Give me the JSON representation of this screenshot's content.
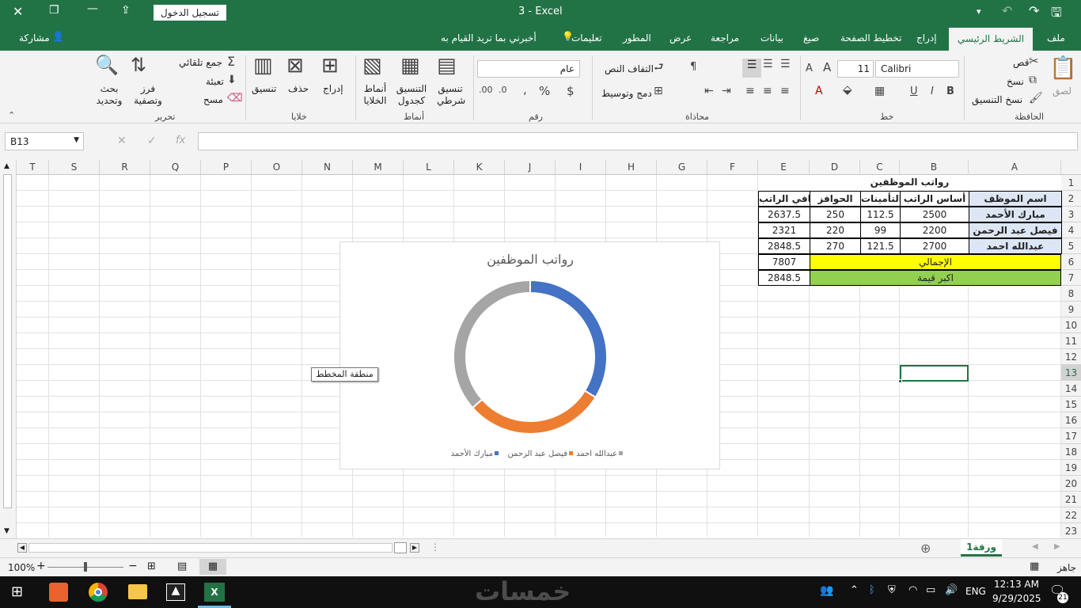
{
  "titlebar": {
    "title": "3  -  Excel",
    "signin": "تسجيل الدخول"
  },
  "tabs": [
    "ملف",
    "الشريط الرئيسي",
    "إدراج",
    "تخطيط الصفحة",
    "صيغ",
    "بيانات",
    "مراجعة",
    "عرض",
    "المطور",
    "تعليمات",
    "أخبرني بما تريد القيام به",
    "مشاركة"
  ],
  "ribbon": {
    "clipboard": {
      "group": "الحافظة",
      "paste": "لصق",
      "cut": "قص",
      "copy": "نسخ",
      "format_painter": "نسخ التنسيق"
    },
    "font": {
      "group": "خط",
      "name": "Calibri",
      "size": "11"
    },
    "alignment": {
      "group": "محاذاة",
      "wrap": "التفاف النص",
      "merge": "دمج وتوسيط"
    },
    "number": {
      "group": "رقم",
      "format": "عام"
    },
    "styles": {
      "group": "أنماط",
      "conditional": "تنسيق شرطي",
      "as_table": "التنسيق كجدول",
      "cell_styles": "أنماط الخلايا"
    },
    "cells": {
      "group": "خلايا",
      "insert": "إدراج",
      "delete": "حذف",
      "format": "تنسيق"
    },
    "editing": {
      "group": "تحرير",
      "autosum": "جمع تلقائي",
      "fill": "تعبئة",
      "clear": "مسح",
      "sort": "فرز وتصفية",
      "find": "بحث وتحديد"
    }
  },
  "formula_bar": {
    "name_box": "B13",
    "formula": ""
  },
  "columns": [
    "A",
    "B",
    "C",
    "D",
    "E",
    "F",
    "G",
    "H",
    "I",
    "J",
    "K",
    "L",
    "M",
    "N",
    "O",
    "P",
    "Q",
    "R",
    "S",
    "T"
  ],
  "rows": [
    "1",
    "2",
    "3",
    "4",
    "5",
    "6",
    "7",
    "8",
    "9",
    "10",
    "11",
    "12",
    "13",
    "14",
    "15",
    "16",
    "17",
    "18",
    "19",
    "20",
    "21",
    "22",
    "23"
  ],
  "table": {
    "title": "رواتب الموظفين",
    "headers": [
      "اسم الموظف",
      "أساس الراتب",
      "التأمينات",
      "الحوافز",
      "صافي الراتب"
    ],
    "rows": [
      [
        "مبارك الأحمد",
        "2500",
        "112.5",
        "250",
        "2637.5"
      ],
      [
        "فيصل عبد الرحمن",
        "2200",
        "99",
        "220",
        "2321"
      ],
      [
        "عبدالله احمد",
        "2700",
        "121.5",
        "270",
        "2848.5"
      ]
    ],
    "total_label": "الإجمالي",
    "total_value": "7807",
    "max_label": "اكبر قيمة",
    "max_value": "2848.5"
  },
  "tooltip": "منطقة المخطط",
  "chart_data": {
    "type": "pie",
    "title": "رواتب الموظفين",
    "categories": [
      "مبارك الأحمد",
      "فيصل عبد الرحمن",
      "عبدالله احمد"
    ],
    "values": [
      2637.5,
      2321,
      2848.5
    ],
    "colors": [
      "#4472c4",
      "#ed7d31",
      "#a5a5a5"
    ],
    "donut": true,
    "legend": "bottom"
  },
  "sheet_tab": "ورقة1",
  "status": {
    "ready": "جاهز",
    "zoom": "100%"
  },
  "taskbar": {
    "time": "12:13 AM",
    "date": "9/29/2025",
    "lang": "ENG",
    "badge": "21"
  },
  "watermark": "خمسات"
}
